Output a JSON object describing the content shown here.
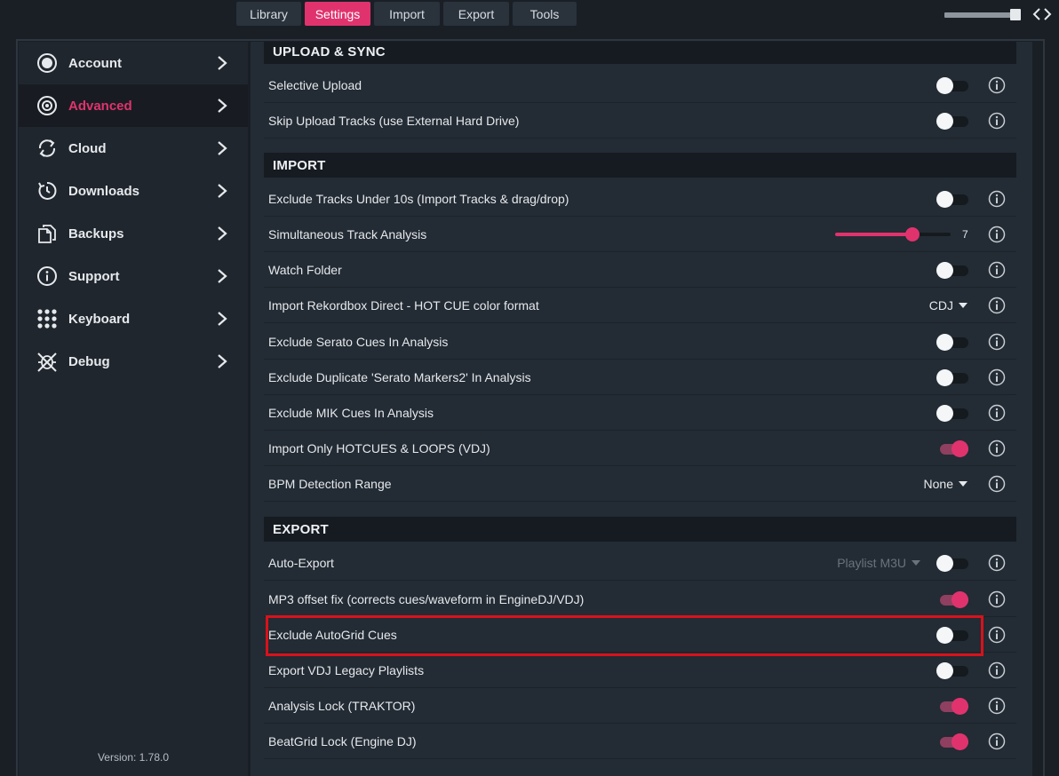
{
  "tabs": [
    {
      "label": "Library",
      "active": false
    },
    {
      "label": "Settings",
      "active": true
    },
    {
      "label": "Import",
      "active": false
    },
    {
      "label": "Export",
      "active": false
    },
    {
      "label": "Tools",
      "active": false
    }
  ],
  "colors": {
    "accent": "#e0336d",
    "highlight": "#d8121b",
    "sidebar_bg": "#20262e",
    "main_bg": "#232b34"
  },
  "sidebar": {
    "items": [
      {
        "label": "Account",
        "icon": "account-icon",
        "active": false
      },
      {
        "label": "Advanced",
        "icon": "advanced-icon",
        "active": true
      },
      {
        "label": "Cloud",
        "icon": "cloud-sync-icon",
        "active": false
      },
      {
        "label": "Downloads",
        "icon": "downloads-icon",
        "active": false
      },
      {
        "label": "Backups",
        "icon": "backups-icon",
        "active": false
      },
      {
        "label": "Support",
        "icon": "support-icon",
        "active": false
      },
      {
        "label": "Keyboard",
        "icon": "keyboard-icon",
        "active": false
      },
      {
        "label": "Debug",
        "icon": "debug-icon",
        "active": false
      }
    ],
    "version": "Version: 1.78.0"
  },
  "sections": {
    "upload": {
      "title": "UPLOAD & SYNC",
      "rows": [
        {
          "label": "Selective Upload",
          "on": false
        },
        {
          "label": "Skip Upload Tracks (use External Hard Drive)",
          "on": false
        }
      ]
    },
    "import": {
      "title": "IMPORT",
      "rows": [
        {
          "label": "Exclude Tracks Under 10s (Import Tracks & drag/drop)",
          "on": false
        },
        {
          "label": "Simultaneous Track Analysis",
          "slider_value": "7",
          "slider_fraction": 0.67
        },
        {
          "label": "Watch Folder",
          "on": false
        },
        {
          "label": "Import Rekordbox Direct - HOT CUE color format",
          "dropdown": "CDJ"
        },
        {
          "label": "Exclude Serato Cues In Analysis",
          "on": false
        },
        {
          "label": "Exclude Duplicate 'Serato Markers2' In Analysis",
          "on": false
        },
        {
          "label": "Exclude MIK Cues In Analysis",
          "on": false
        },
        {
          "label": "Import Only HOTCUES & LOOPS (VDJ)",
          "on": true
        },
        {
          "label": "BPM Detection Range",
          "dropdown": "None"
        }
      ]
    },
    "export": {
      "title": "EXPORT",
      "rows": [
        {
          "label": "Auto-Export",
          "on": false,
          "dropdown": "Playlist M3U"
        },
        {
          "label": "MP3 offset fix (corrects cues/waveform in EngineDJ/VDJ)",
          "on": true
        },
        {
          "label": "Exclude AutoGrid Cues",
          "on": false
        },
        {
          "label": "Export VDJ Legacy Playlists",
          "on": false
        },
        {
          "label": "Analysis Lock (TRAKTOR)",
          "on": true
        },
        {
          "label": "BeatGrid Lock (Engine DJ)",
          "on": true
        }
      ]
    }
  }
}
